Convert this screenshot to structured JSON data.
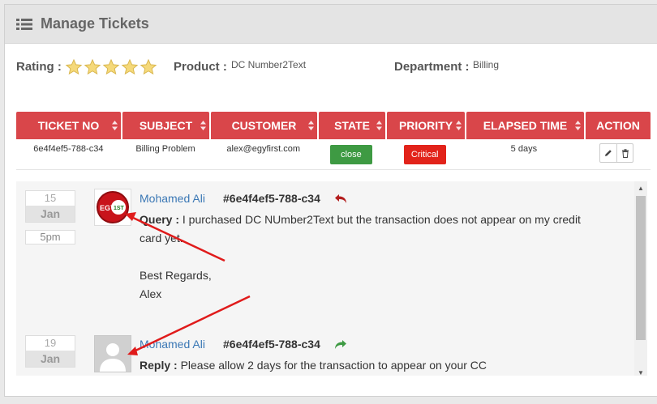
{
  "header": {
    "title": "Manage Tickets",
    "icon": "list-icon"
  },
  "meta": {
    "rating_label": "Rating :",
    "rating_value": 5,
    "rating_max": 5,
    "product_label": "Product :",
    "product_value": "DC Number2Text",
    "department_label": "Department :",
    "department_value": "Billing"
  },
  "table": {
    "columns": [
      "TICKET NO",
      "SUBJECT",
      "CUSTOMER",
      "STATE",
      "PRIORITY",
      "ELAPSED TIME",
      "ACTION"
    ],
    "row": {
      "ticket_no": "6e4f4ef5-788-c34",
      "subject": "Billing Problem",
      "customer": "alex@egyfirst.com",
      "state": "close",
      "priority": "Critical",
      "elapsed": "5 days"
    }
  },
  "messages": [
    {
      "day": "15",
      "month": "Jan",
      "time": "5pm",
      "author": "Mohamed Ali",
      "ticket_ref": "#6e4f4ef5-788-c34",
      "kind": "Query :",
      "text": " I purchased DC NUmber2Text but the transaction does not appear on my credit card yet.",
      "signoff": "Best Regards,",
      "signature": "Alex",
      "avatar_logo": "EGY 1ST"
    },
    {
      "day": "19",
      "month": "Jan",
      "author": "Mohamed Ali",
      "ticket_ref": "#6e4f4ef5-788-c34",
      "kind": "Reply :",
      "text": " Please allow 2 days for the transaction to appear on your CC"
    }
  ],
  "colors": {
    "header_red": "#d9464a",
    "state_green": "#3e9a43",
    "priority_red": "#e2231a",
    "link_blue": "#3b78b5",
    "annotation_red": "#e01b1b"
  }
}
